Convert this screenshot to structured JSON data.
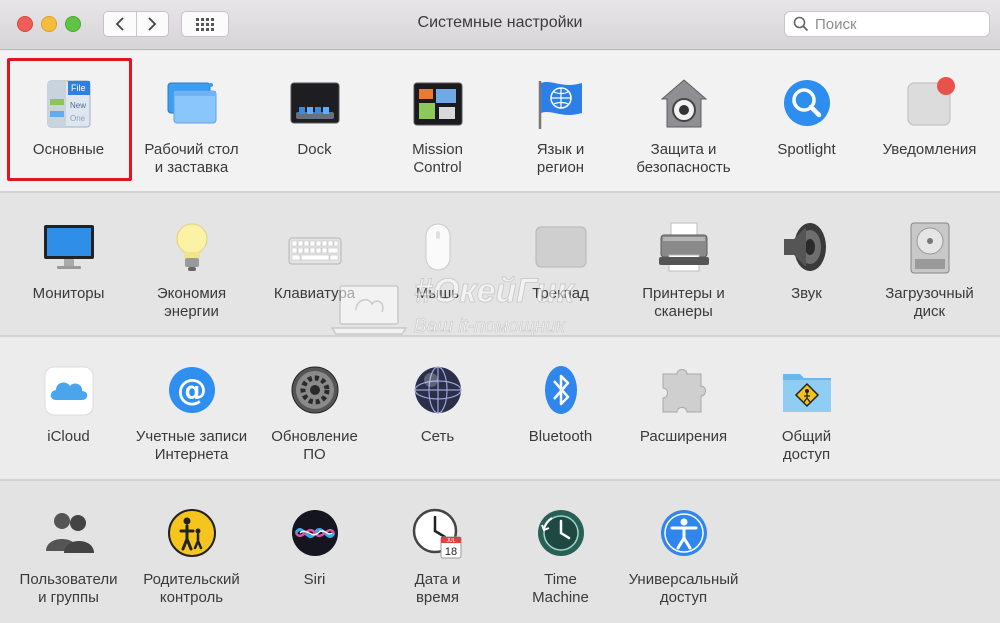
{
  "window": {
    "title": "Системные настройки",
    "search_placeholder": "Поиск"
  },
  "watermark": {
    "title": "#ОкейГик",
    "subtitle": "Ваш it-помощник"
  },
  "sections": [
    [
      {
        "id": "general",
        "label": "Основные",
        "icon": "general-icon"
      },
      {
        "id": "desktop",
        "label": "Рабочий стол\nи заставка",
        "icon": "desktop-screensaver-icon"
      },
      {
        "id": "dock",
        "label": "Dock",
        "icon": "dock-icon"
      },
      {
        "id": "mission",
        "label": "Mission\nControl",
        "icon": "mission-control-icon"
      },
      {
        "id": "language",
        "label": "Язык и\nрегион",
        "icon": "language-region-icon"
      },
      {
        "id": "security",
        "label": "Защита и\nбезопасность",
        "icon": "security-icon"
      },
      {
        "id": "spotlight",
        "label": "Spotlight",
        "icon": "spotlight-icon"
      },
      {
        "id": "notifications",
        "label": "Уведомления",
        "icon": "notifications-icon"
      }
    ],
    [
      {
        "id": "displays",
        "label": "Мониторы",
        "icon": "displays-icon"
      },
      {
        "id": "energy",
        "label": "Экономия\nэнергии",
        "icon": "energy-saver-icon"
      },
      {
        "id": "keyboard",
        "label": "Клавиатура",
        "icon": "keyboard-icon"
      },
      {
        "id": "mouse",
        "label": "Мышь",
        "icon": "mouse-icon"
      },
      {
        "id": "trackpad",
        "label": "Трекпад",
        "icon": "trackpad-icon"
      },
      {
        "id": "printers",
        "label": "Принтеры и\nсканеры",
        "icon": "printer-icon"
      },
      {
        "id": "sound",
        "label": "Звук",
        "icon": "speaker-icon"
      },
      {
        "id": "startup",
        "label": "Загрузочный\nдиск",
        "icon": "startup-disk-icon"
      }
    ],
    [
      {
        "id": "icloud",
        "label": "iCloud",
        "icon": "icloud-icon"
      },
      {
        "id": "internet",
        "label": "Учетные записи\nИнтернета",
        "icon": "internet-accounts-icon"
      },
      {
        "id": "update",
        "label": "Обновление\nПО",
        "icon": "software-update-icon"
      },
      {
        "id": "network",
        "label": "Сеть",
        "icon": "network-icon"
      },
      {
        "id": "bluetooth",
        "label": "Bluetooth",
        "icon": "bluetooth-icon"
      },
      {
        "id": "extensions",
        "label": "Расширения",
        "icon": "extensions-icon"
      },
      {
        "id": "sharing",
        "label": "Общий\nдоступ",
        "icon": "sharing-icon"
      }
    ],
    [
      {
        "id": "users",
        "label": "Пользователи\nи группы",
        "icon": "users-groups-icon"
      },
      {
        "id": "parental",
        "label": "Родительский\nконтроль",
        "icon": "parental-controls-icon"
      },
      {
        "id": "siri",
        "label": "Siri",
        "icon": "siri-icon"
      },
      {
        "id": "datetime",
        "label": "Дата и\nвремя",
        "icon": "date-time-icon"
      },
      {
        "id": "timemachine",
        "label": "Time\nMachine",
        "icon": "time-machine-icon"
      },
      {
        "id": "accessibility",
        "label": "Универсальный\nдоступ",
        "icon": "accessibility-icon"
      }
    ]
  ],
  "general_icon_text": [
    "File",
    "New",
    "One"
  ],
  "date_icon_text": [
    "JUL",
    "18"
  ]
}
